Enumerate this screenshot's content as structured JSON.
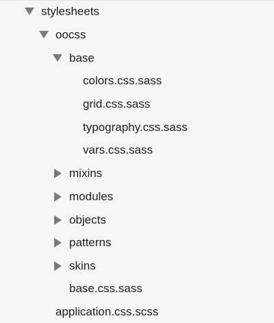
{
  "tree": {
    "stylesheets": {
      "label": "stylesheets",
      "state": "expanded",
      "icon": "disclosure-down-icon"
    },
    "oocss": {
      "label": "oocss",
      "state": "expanded",
      "icon": "disclosure-down-icon"
    },
    "base": {
      "label": "base",
      "state": "expanded",
      "icon": "disclosure-down-icon"
    },
    "base_files": [
      "colors.css.sass",
      "grid.css.sass",
      "typography.css.sass",
      "vars.css.sass"
    ],
    "collapsed_folders": [
      {
        "label": "mixins",
        "state": "collapsed",
        "icon": "disclosure-right-icon"
      },
      {
        "label": "modules",
        "state": "collapsed",
        "icon": "disclosure-right-icon"
      },
      {
        "label": "objects",
        "state": "collapsed",
        "icon": "disclosure-right-icon"
      },
      {
        "label": "patterns",
        "state": "collapsed",
        "icon": "disclosure-right-icon"
      },
      {
        "label": "skins",
        "state": "collapsed",
        "icon": "disclosure-right-icon"
      }
    ],
    "oocss_file": "base.css.sass",
    "root_file": "application.css.scss"
  },
  "colors": {
    "disclosure_arrow": "#7a7a7a",
    "text": "#1e1e1e",
    "background": "#f6f6f6"
  }
}
